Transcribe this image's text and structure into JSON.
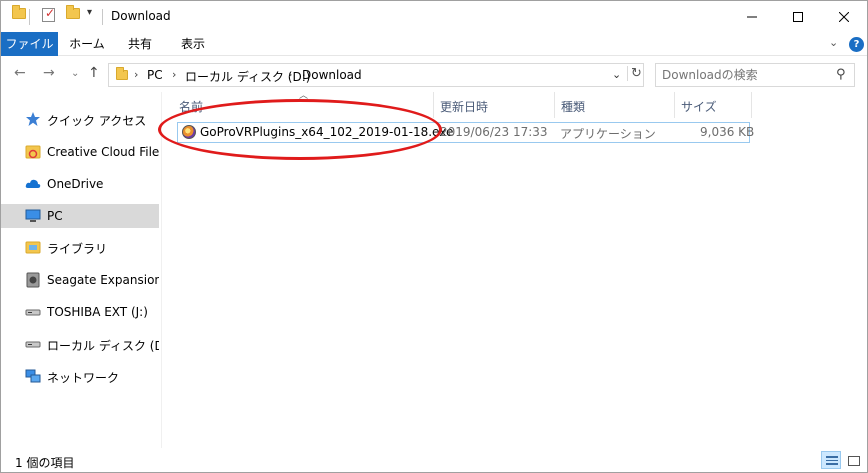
{
  "window": {
    "title": "Download"
  },
  "ribbon": {
    "tabs": [
      "ファイル",
      "ホーム",
      "共有",
      "表示"
    ]
  },
  "address": {
    "crumbs": [
      "PC",
      "ローカル ディスク (D:)",
      "Download"
    ],
    "search_placeholder": "Downloadの検索"
  },
  "sidebar": {
    "items": [
      {
        "label": "クイック アクセス",
        "icon": "star-icon"
      },
      {
        "label": "Creative Cloud Files",
        "icon": "creative-cloud-icon"
      },
      {
        "label": "OneDrive",
        "icon": "cloud-icon"
      },
      {
        "label": "PC",
        "icon": "computer-icon"
      },
      {
        "label": "ライブラリ",
        "icon": "library-icon"
      },
      {
        "label": "Seagate Expansion Dr",
        "icon": "usb-drive-icon"
      },
      {
        "label": "TOSHIBA EXT (J:)",
        "icon": "drive-icon"
      },
      {
        "label": "ローカル ディスク (D:)",
        "icon": "drive-icon"
      },
      {
        "label": "ネットワーク",
        "icon": "network-icon"
      }
    ],
    "selected": "PC"
  },
  "list": {
    "columns": [
      "名前",
      "更新日時",
      "種類",
      "サイズ"
    ],
    "sort_column": "名前",
    "files": [
      {
        "name": "GoProVRPlugins_x64_102_2019-01-18.exe",
        "modified": "2019/06/23 17:33",
        "type": "アプリケーション",
        "size": "9,036 KB"
      }
    ]
  },
  "status": {
    "item_count": "1 個の項目"
  },
  "colors": {
    "accent": "#1a6ec4",
    "selection_border": "#99c9ef",
    "annotation": "#e01b1b"
  }
}
